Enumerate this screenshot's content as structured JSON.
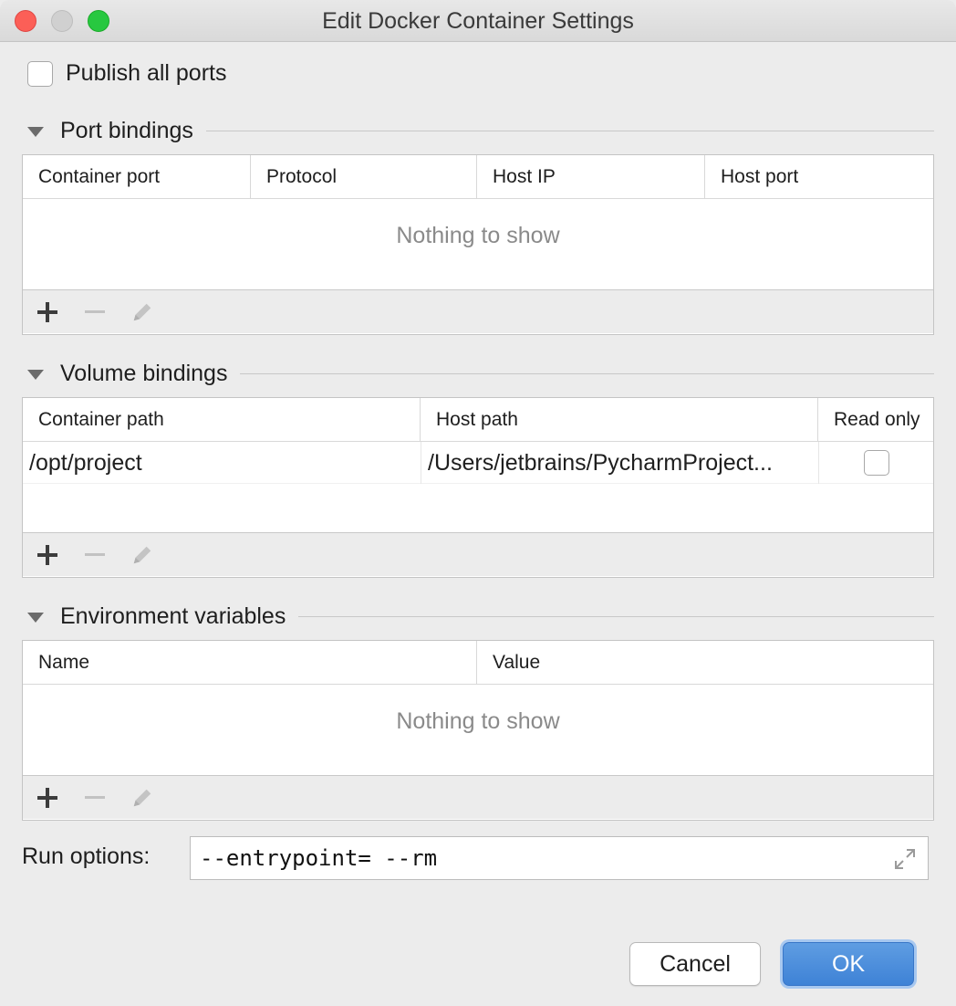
{
  "window": {
    "title": "Edit Docker Container Settings"
  },
  "publish": {
    "label": "Publish all ports",
    "checked": false
  },
  "port_bindings": {
    "title": "Port bindings",
    "columns": [
      "Container port",
      "Protocol",
      "Host IP",
      "Host port"
    ],
    "empty_text": "Nothing to show"
  },
  "volume_bindings": {
    "title": "Volume bindings",
    "columns": [
      "Container path",
      "Host path",
      "Read only"
    ],
    "rows": [
      {
        "container_path": "/opt/project",
        "host_path": "/Users/jetbrains/PycharmProject...",
        "read_only": false
      }
    ]
  },
  "env_vars": {
    "title": "Environment variables",
    "columns": [
      "Name",
      "Value"
    ],
    "empty_text": "Nothing to show"
  },
  "run_options": {
    "label": "Run options:",
    "value": "--entrypoint= --rm"
  },
  "buttons": {
    "cancel": "Cancel",
    "ok": "OK"
  },
  "colors": {
    "accent": "#3e82d6",
    "close": "#fc5f57",
    "maximize": "#28c840"
  }
}
